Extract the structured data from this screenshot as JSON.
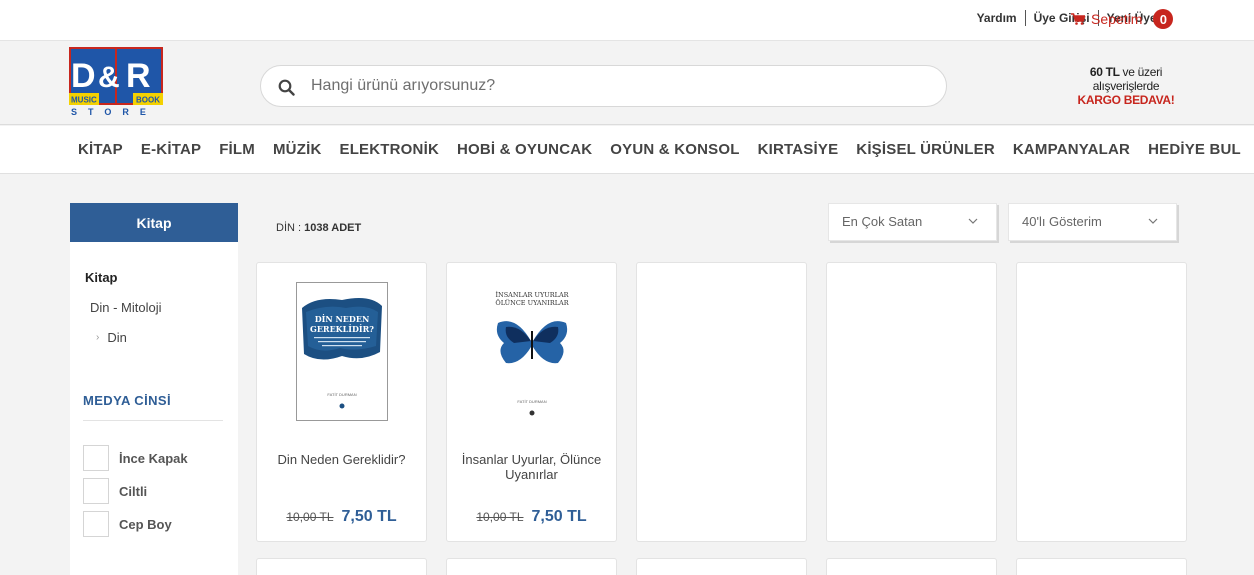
{
  "toplinks": {
    "help": "Yardım",
    "login": "Üye Girişi",
    "register": "Yeni Üyelik"
  },
  "cart": {
    "label": "Sepetim",
    "count": "0"
  },
  "logo": {
    "brand": "D&R",
    "left_tag": "MUSIC",
    "right_tag": "BOOK",
    "store": "STORE"
  },
  "search": {
    "placeholder": "Hangi ürünü arıyorsunuz?"
  },
  "promo": {
    "amount": "60 TL",
    "line1_rest": "ve üzeri",
    "line2": "alışverişlerde",
    "line3": "KARGO BEDAVA!"
  },
  "nav": [
    "KİTAP",
    "E-KİTAP",
    "FİLM",
    "MÜZİK",
    "ELEKTRONİK",
    "HOBİ & OYUNCAK",
    "OYUN & KONSOL",
    "KIRTASİYE",
    "KİŞİSEL ÜRÜNLER",
    "KAMPANYALAR",
    "HEDİYE BUL"
  ],
  "sidebar": {
    "header": "Kitap",
    "categories": {
      "root": "Kitap",
      "sub": "Din - Mitoloji",
      "leaf": "Din"
    },
    "media_title": "MEDYA CİNSİ",
    "media_options": [
      "İnce Kapak",
      "Ciltli",
      "Cep Boy"
    ]
  },
  "results": {
    "category": "DİN",
    "count": "1038 ADET"
  },
  "sort": {
    "selected": "En Çok Satan"
  },
  "page_size": {
    "selected": "40'lı Gösterim"
  },
  "products": [
    {
      "title": "Din Neden Gereklidir?",
      "old_price": "10,00 TL",
      "new_price": "7,50 TL",
      "cover_title": "DİN NEDEN GEREKLİDİR?",
      "cover_author": "FATİT DURMAN"
    },
    {
      "title": "İnsanlar Uyurlar, Ölünce Uyanırlar",
      "old_price": "10,00 TL",
      "new_price": "7,50 TL",
      "cover_title_1": "İNSANLAR UYURLAR",
      "cover_title_2": "ÖLÜNCE UYANIRLAR",
      "cover_author": "FATİT DURMAN"
    }
  ],
  "colors": {
    "brand_blue": "#2f5e96",
    "brand_red": "#c7261e",
    "logo_yellow": "#f4d100"
  }
}
